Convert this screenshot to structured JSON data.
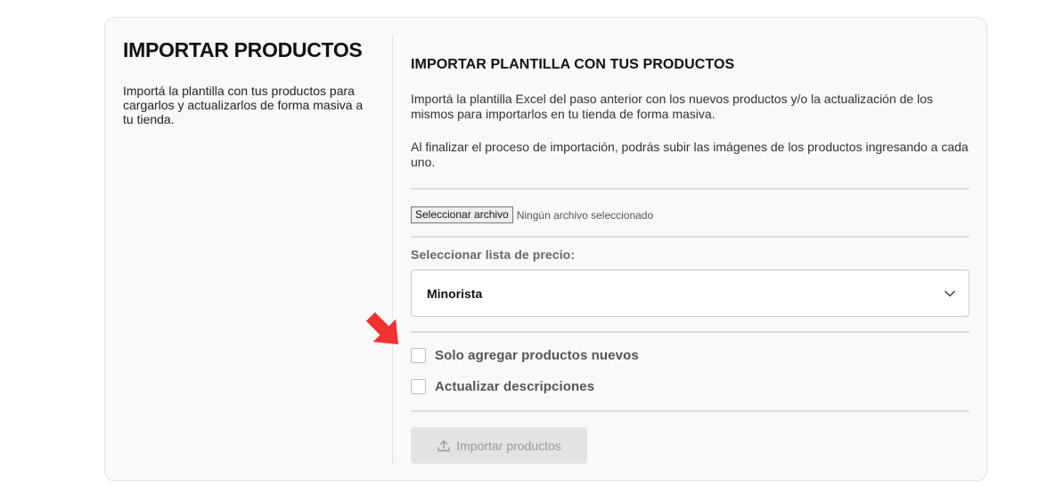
{
  "left": {
    "title": "IMPORTAR PRODUCTOS",
    "description": "Importá la plantilla con tus productos para cargarlos y actualizarlos de forma masiva a tu tienda."
  },
  "right": {
    "title": "IMPORTAR PLANTILLA CON TUS PRODUCTOS",
    "paragraph1": "Importá la plantilla Excel del paso anterior con los nuevos productos y/o la actualización de los mismos para importarlos en tu tienda de forma masiva.",
    "paragraph2": "Al finalizar el proceso de importación, podrás subir las imágenes de los productos ingresando a cada uno.",
    "file_button_label": "Seleccionar archivo",
    "file_status": "Ningún archivo seleccionado",
    "price_list_label": "Seleccionar lista de precio:",
    "price_list_value": "Minorista",
    "checkbox_new_only": "Solo agregar productos nuevos",
    "checkbox_update_desc": "Actualizar descripciones",
    "import_button_label": "Importar productos"
  },
  "icons": {
    "chevron": "chevron-down-icon",
    "upload": "upload-icon",
    "arrow": "red-pointer-arrow"
  },
  "colors": {
    "arrow": "#f03232",
    "card_bg": "#f9f9f9",
    "button_disabled_bg": "#e3e3e3"
  }
}
